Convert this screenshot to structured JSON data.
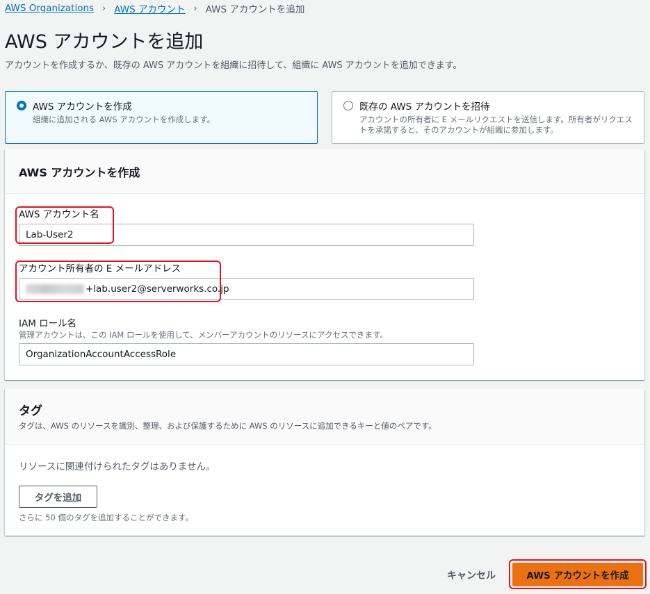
{
  "breadcrumb": {
    "items": [
      "AWS Organizations",
      "AWS アカウント",
      "AWS アカウントを追加"
    ],
    "separator": "›"
  },
  "page": {
    "title": "AWS アカウントを追加",
    "description": "アカウントを作成するか、既存の AWS アカウントを組織に招待して、組織に AWS アカウントを追加できます。"
  },
  "options": [
    {
      "title": "AWS アカウントを作成",
      "desc": "組織に追加される AWS アカウントを作成します。",
      "selected": true
    },
    {
      "title": "既存の AWS アカウントを招待",
      "desc": "アカウントの所有者に E メールリクエストを送信します。所有者がリクエストを承諾すると、そのアカウントが組織に参加します。",
      "selected": false
    }
  ],
  "create_panel": {
    "title": "AWS アカウントを作成",
    "account_name_label": "AWS アカウント名",
    "account_name_value": "Lab-User2",
    "email_label": "アカウント所有者の E メールアドレス",
    "email_value_visible": "+lab.user2@serverworks.co.jp",
    "iam_role_label": "IAM ロール名",
    "iam_role_desc": "管理アカウントは、この IAM ロールを使用して、メンバーアカウントのリソースにアクセスできます。",
    "iam_role_value": "OrganizationAccountAccessRole"
  },
  "tags_panel": {
    "title": "タグ",
    "desc": "タグは、AWS のリソースを識別、整理、および保護するために AWS のリソースに追加できるキーと値のペアです。",
    "empty_text": "リソースに関連付けられたタグはありません。",
    "add_button": "タグを追加",
    "limit_text": "さらに 50 個のタグを追加することができます。"
  },
  "footer": {
    "cancel_label": "キャンセル",
    "submit_label": "AWS アカウントを作成"
  },
  "colors": {
    "link": "#0073bb",
    "primary": "#ec7211",
    "highlight": "#e5101d"
  }
}
